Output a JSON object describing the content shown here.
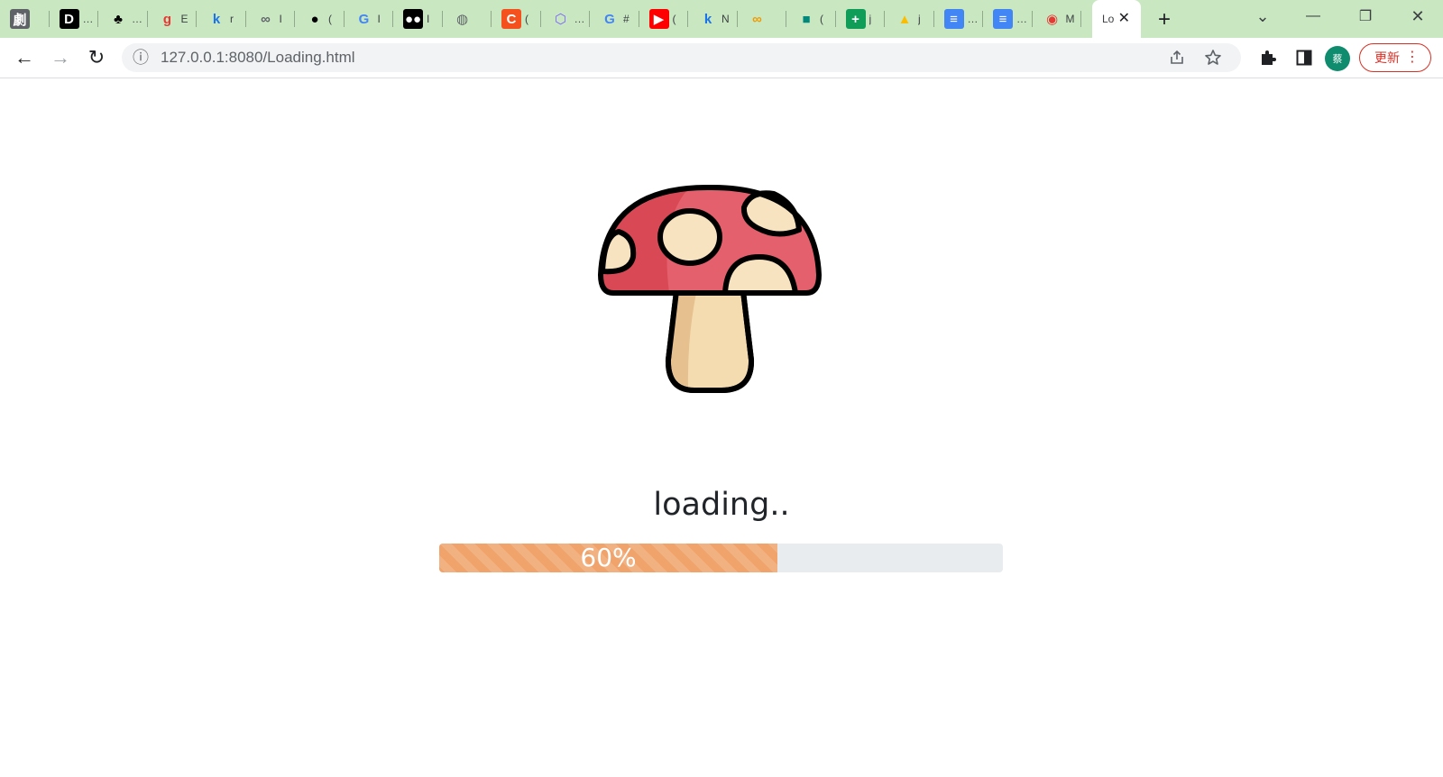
{
  "browser": {
    "tabs": [
      {
        "favicon": "劇",
        "title": "",
        "fav_bg": "#5f6368",
        "fav_fg": "#ffffff"
      },
      {
        "favicon": "D",
        "title": "…",
        "fav_bg": "#000000",
        "fav_fg": "#ffffff"
      },
      {
        "favicon": "♣",
        "title": "…",
        "fav_bg": "transparent",
        "fav_fg": "#000000"
      },
      {
        "favicon": "g",
        "title": "E",
        "fav_bg": "transparent",
        "fav_fg": "#e53935"
      },
      {
        "favicon": "k",
        "title": "r",
        "fav_bg": "transparent",
        "fav_fg": "#1a73e8"
      },
      {
        "favicon": "∞",
        "title": "I",
        "fav_bg": "transparent",
        "fav_fg": "#5f6368"
      },
      {
        "favicon": "●",
        "title": "(",
        "fav_bg": "transparent",
        "fav_fg": "#000000"
      },
      {
        "favicon": "G",
        "title": "I",
        "fav_bg": "transparent",
        "fav_fg": "#4285f4"
      },
      {
        "favicon": "●●",
        "title": "I",
        "fav_bg": "#000000",
        "fav_fg": "#ffffff"
      },
      {
        "favicon": "◍",
        "title": "",
        "fav_bg": "transparent",
        "fav_fg": "#5f6368"
      },
      {
        "favicon": "C",
        "title": "(",
        "fav_bg": "#f4511e",
        "fav_fg": "#ffffff"
      },
      {
        "favicon": "⬡",
        "title": "…",
        "fav_bg": "transparent",
        "fav_fg": "#7b61ff"
      },
      {
        "favicon": "G",
        "title": "#",
        "fav_bg": "transparent",
        "fav_fg": "#4285f4"
      },
      {
        "favicon": "▶",
        "title": "(",
        "fav_bg": "#ff0000",
        "fav_fg": "#ffffff"
      },
      {
        "favicon": "k",
        "title": "N",
        "fav_bg": "transparent",
        "fav_fg": "#1a73e8"
      },
      {
        "favicon": "∞",
        "title": "",
        "fav_bg": "transparent",
        "fav_fg": "#f29900"
      },
      {
        "favicon": "■",
        "title": "(",
        "fav_bg": "transparent",
        "fav_fg": "#00897b"
      },
      {
        "favicon": "+",
        "title": "j",
        "fav_bg": "#0f9d58",
        "fav_fg": "#ffffff"
      },
      {
        "favicon": "▲",
        "title": "j",
        "fav_bg": "transparent",
        "fav_fg": "#fbbc04"
      },
      {
        "favicon": "≡",
        "title": "…",
        "fav_bg": "#4285f4",
        "fav_fg": "#ffffff"
      },
      {
        "favicon": "≡",
        "title": "…",
        "fav_bg": "#4285f4",
        "fav_fg": "#ffffff"
      },
      {
        "favicon": "◉",
        "title": "M",
        "fav_bg": "transparent",
        "fav_fg": "#e53935"
      }
    ],
    "active_tab": {
      "title": "Lo",
      "close": "✕"
    },
    "new_tab": "+",
    "window_controls": {
      "list": "⌄",
      "minimize": "—",
      "restore": "❐",
      "close": "✕"
    },
    "nav": {
      "back": "←",
      "forward": "→",
      "reload": "↻"
    },
    "address": {
      "url": "127.0.0.1:8080/Loading.html",
      "info_icon": "ⓘ"
    },
    "profile_initial": "蔡",
    "update_label": "更新",
    "menu_dots": "⋮"
  },
  "page": {
    "loading_text": "loading..",
    "progress": {
      "value": 60,
      "label": "60%",
      "color": "#f0a36b"
    }
  }
}
